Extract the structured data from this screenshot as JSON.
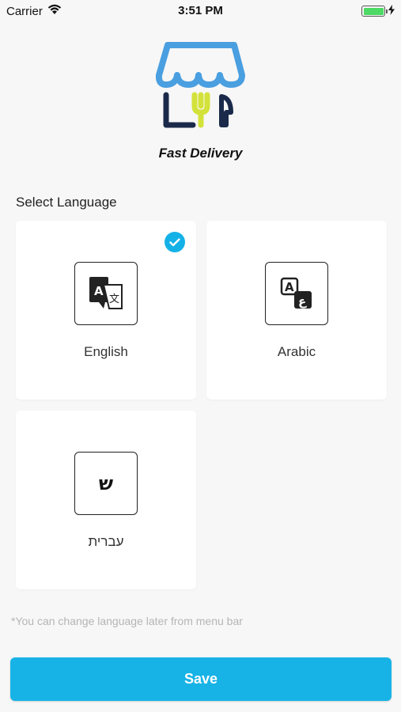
{
  "status_bar": {
    "carrier": "Carrier",
    "time": "3:51 PM",
    "battery_level": 1.0
  },
  "brand": {
    "name": "Fast Delivery",
    "logo_icon": "storefront-fork-knife-icon",
    "colors": {
      "awning": "#4a9fe0",
      "fork": "#d3e23a",
      "navy": "#1b2a4a"
    }
  },
  "language_section": {
    "title": "Select Language",
    "selected": "English",
    "options": [
      {
        "label": "English",
        "icon": "translate-icon",
        "selected": true
      },
      {
        "label": "Arabic",
        "icon": "arabic-translate-icon",
        "selected": false
      },
      {
        "label": "עברית",
        "icon": "hebrew-letter-icon",
        "glyph": "ש",
        "selected": false
      }
    ]
  },
  "hint": "*You can change language later from menu bar",
  "save_label": "Save",
  "accent_color": "#17b3e6"
}
